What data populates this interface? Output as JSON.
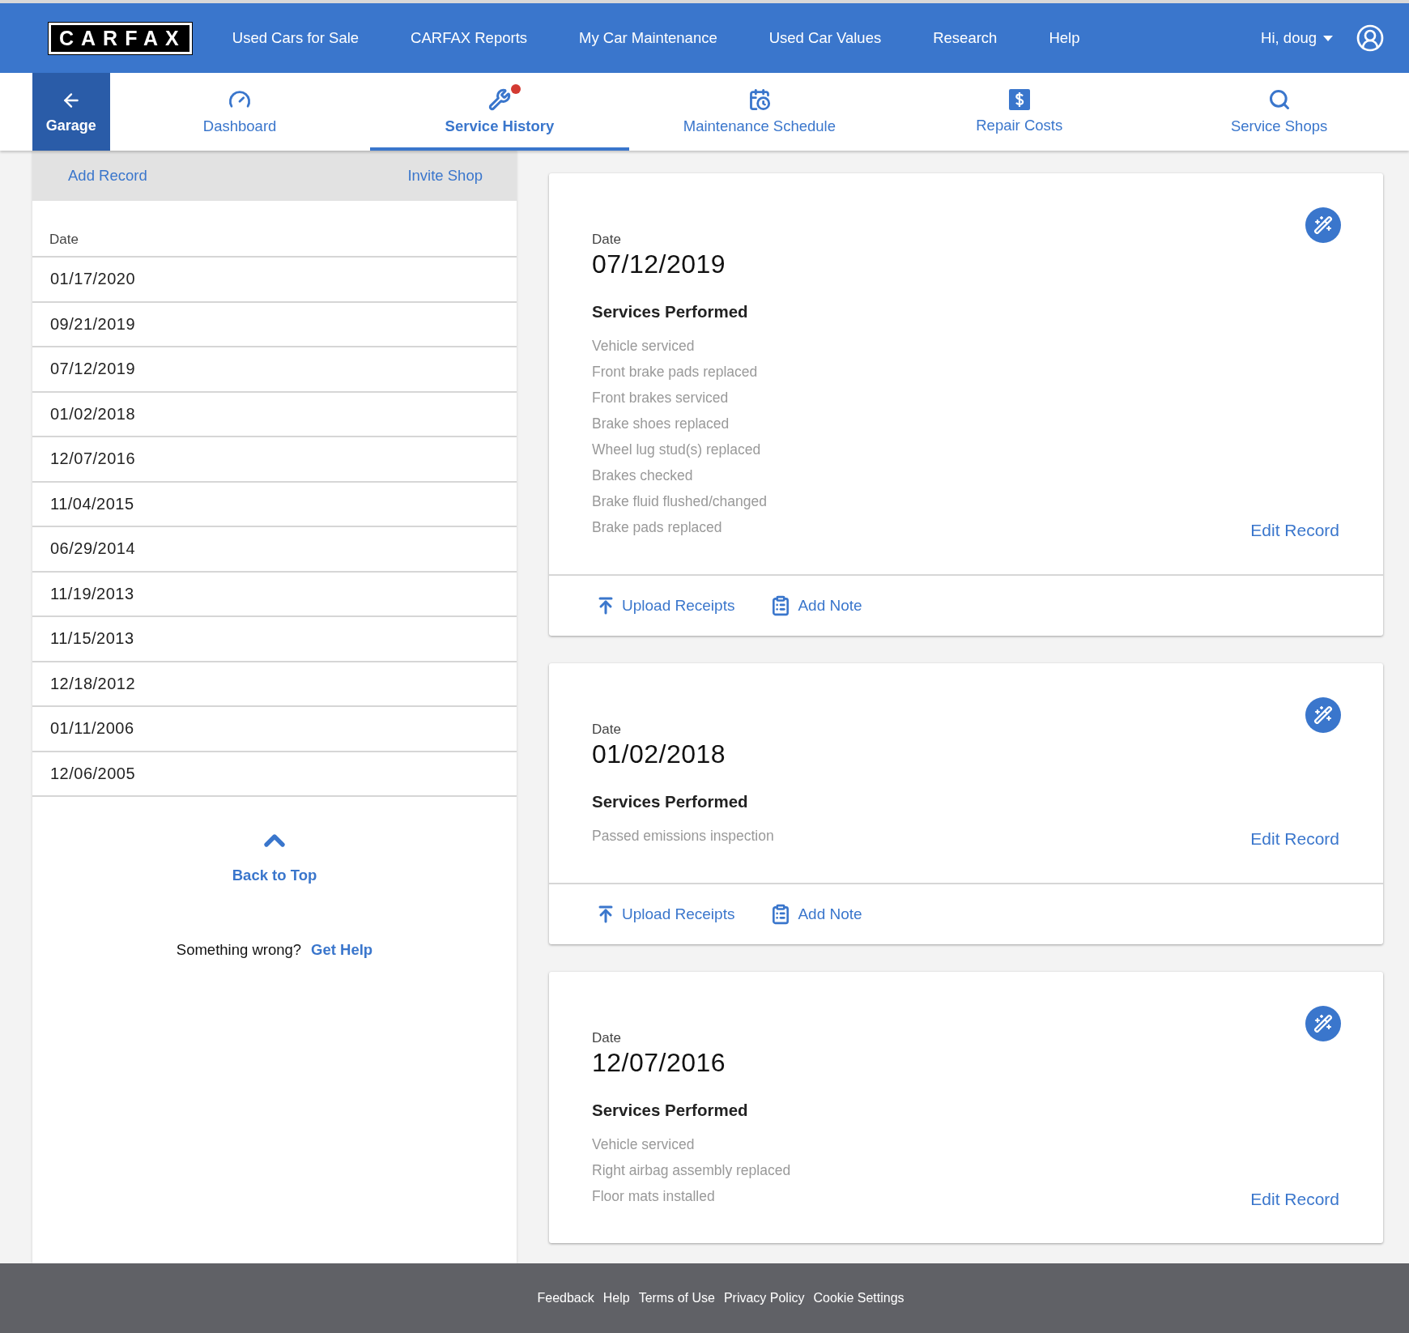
{
  "header": {
    "logo": "CARFAX",
    "links": [
      "Used Cars for Sale",
      "CARFAX Reports",
      "My Car Maintenance",
      "Used Car Values",
      "Research",
      "Help"
    ],
    "user": "Hi, doug"
  },
  "subnav": {
    "back": "Garage",
    "tabs": [
      {
        "kind": "dashboard",
        "label": "Dashboard",
        "selected": false,
        "notification": false
      },
      {
        "kind": "service",
        "label": "Service History",
        "selected": true,
        "notification": true
      },
      {
        "kind": "schedule",
        "label": "Maintenance Schedule",
        "selected": false,
        "notification": false
      },
      {
        "kind": "costs",
        "label": "Repair Costs",
        "selected": false,
        "notification": false
      },
      {
        "kind": "shops",
        "label": "Service Shops",
        "selected": false,
        "notification": false
      }
    ]
  },
  "sidebar": {
    "actions": [
      "Add Record",
      "Invite Shop"
    ],
    "column": "Date",
    "dates": [
      "01/17/2020",
      "09/21/2019",
      "07/12/2019",
      "01/02/2018",
      "12/07/2016",
      "11/04/2015",
      "06/29/2014",
      "11/19/2013",
      "11/15/2013",
      "12/18/2012",
      "01/11/2006",
      "12/06/2005"
    ],
    "back_to_top": "Back to Top",
    "help_text": "Something wrong?",
    "help_link": "Get Help"
  },
  "records": [
    {
      "date_label": "Date",
      "date": "07/12/2019",
      "services_title": "Services Performed",
      "services": [
        "Vehicle serviced",
        "Front brake pads replaced",
        "Front brakes serviced",
        "Brake shoes replaced",
        "Wheel lug stud(s) replaced",
        "Brakes checked",
        "Brake fluid flushed/changed",
        "Brake pads replaced"
      ],
      "edit": "Edit Record",
      "upload": "Upload Receipts",
      "note": "Add Note"
    },
    {
      "date_label": "Date",
      "date": "01/02/2018",
      "services_title": "Services Performed",
      "services": [
        "Passed emissions inspection"
      ],
      "edit": "Edit Record",
      "upload": "Upload Receipts",
      "note": "Add Note"
    },
    {
      "date_label": "Date",
      "date": "12/07/2016",
      "services_title": "Services Performed",
      "services": [
        "Vehicle serviced",
        "Right airbag assembly replaced",
        "Floor mats installed"
      ],
      "edit": "Edit Record"
    }
  ],
  "footer": [
    "Feedback",
    "Help",
    "Terms of Use",
    "Privacy Policy",
    "Cookie Settings"
  ]
}
